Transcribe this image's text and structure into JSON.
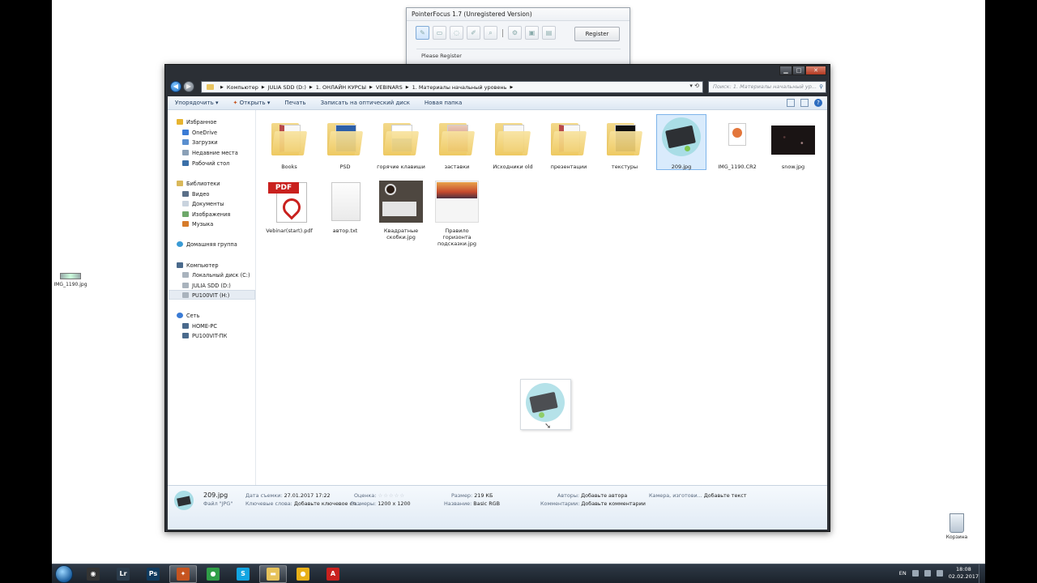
{
  "pointerfocus": {
    "title": "PointerFocus 1.7 (Unregistered Version)",
    "register_label": "Register",
    "note": "Please Register"
  },
  "desktop": {
    "icon_left_label": "IMG_1190.jpg",
    "recycle_label": "Корзина"
  },
  "explorer": {
    "breadcrumbs": [
      "Компьютер",
      "JULIA SDD (D:)",
      "1. ОНЛАЙН КУРСЫ",
      "VEBINARS",
      "1. Материалы начальный уровень"
    ],
    "search_placeholder": "Поиск: 1. Материалы начальный ур...",
    "commands": {
      "organize": "Упорядочить ▾",
      "open": "Открыть ▾",
      "print": "Печать",
      "burn": "Записать на оптический диск",
      "new_folder": "Новая папка"
    },
    "nav": {
      "favorites": "Избранное",
      "onedrive": "OneDrive",
      "downloads": "Загрузки",
      "recent": "Недавние места",
      "desktop": "Рабочий стол",
      "libraries": "Библиотеки",
      "video": "Видео",
      "documents": "Документы",
      "images": "Изображения",
      "music": "Музыка",
      "homegroup": "Домашняя группа",
      "computer": "Компьютер",
      "local_c": "Локальный диск (C:)",
      "julia_d": "JULIA SDD (D:)",
      "pu100vit_h": "PU100VIT (H:)",
      "network": "Сеть",
      "home_pc": "HOME-PC",
      "pu100vit_pk": "PU100VIT-ПК"
    },
    "items": [
      {
        "name": "Books",
        "kind": "folder",
        "accent": "#b84a4a"
      },
      {
        "name": "PSD",
        "kind": "folder",
        "accent": "#2d5fa8"
      },
      {
        "name": "горячие клавиши",
        "kind": "folder",
        "accent": "#5c8fc7"
      },
      {
        "name": "заставки",
        "kind": "folder",
        "accent": "#c86a55"
      },
      {
        "name": "Исходники old",
        "kind": "folder",
        "accent": "#d8d8d8"
      },
      {
        "name": "презентации",
        "kind": "folder",
        "accent": "#b84a4a"
      },
      {
        "name": "текстуры",
        "kind": "folder",
        "accent": "#111111"
      },
      {
        "name": "209.jpg",
        "kind": "image",
        "accent": "#5fb7c9"
      },
      {
        "name": "IMG_1190.CR2",
        "kind": "raw",
        "accent": "#e3763b"
      },
      {
        "name": "snow.jpg",
        "kind": "image-dark",
        "accent": "#1a1414"
      },
      {
        "name": "Vebinar(start).pdf",
        "kind": "pdf",
        "accent": "#c9211e"
      },
      {
        "name": "автор.txt",
        "kind": "txt",
        "accent": "#eeeeee"
      },
      {
        "name": "Квадратные скобки.jpg",
        "kind": "photo",
        "accent": "#5a4a3c"
      },
      {
        "name": "Правило горизонта подсказки.jpg",
        "kind": "sunset",
        "accent": "#e88a36"
      }
    ],
    "details": {
      "filename": "209.jpg",
      "filetype": "Файл \"JPG\"",
      "date_label": "Дата съемки:",
      "date_value": "27.01.2017 17:22",
      "keywords_label": "Ключевые слова:",
      "keywords_value": "Добавьте ключевое сл...",
      "rating_label": "Оценка:",
      "rating_stars": 0,
      "size_label": "Размер:",
      "size_value": "219 КБ",
      "dims_label": "Размеры:",
      "dims_value": "1200 x 1200",
      "title_label": "Название:",
      "title_value": "Basic RGB",
      "authors_label": "Авторы:",
      "authors_value": "Добавьте автора",
      "comments_label": "Комментарии:",
      "comments_value": "Добавьте комментарии",
      "camera_label": "Камера, изготови...",
      "camera_value": "Добавьте текст"
    }
  },
  "taskbar": {
    "lang": "EN",
    "time": "18:08",
    "date": "02.02.2017",
    "apps": [
      {
        "name": "obs",
        "glyph": "◉",
        "color": "#333333",
        "open": false
      },
      {
        "name": "lightroom",
        "glyph": "Lr",
        "color": "#2b3c4c",
        "open": false
      },
      {
        "name": "photoshop",
        "glyph": "Ps",
        "color": "#0f3a5e",
        "open": false
      },
      {
        "name": "pointerfocus",
        "glyph": "✦",
        "color": "#c6541f",
        "open": true
      },
      {
        "name": "chrome",
        "glyph": "●",
        "color": "#2f9e47",
        "open": false
      },
      {
        "name": "skype",
        "glyph": "S",
        "color": "#12a5e2",
        "open": false
      },
      {
        "name": "explorer",
        "glyph": "▬",
        "color": "#e7c35a",
        "open": true
      },
      {
        "name": "coin",
        "glyph": "●",
        "color": "#e8b018",
        "open": false
      },
      {
        "name": "acrobat",
        "glyph": "A",
        "color": "#c9211e",
        "open": false
      }
    ]
  }
}
